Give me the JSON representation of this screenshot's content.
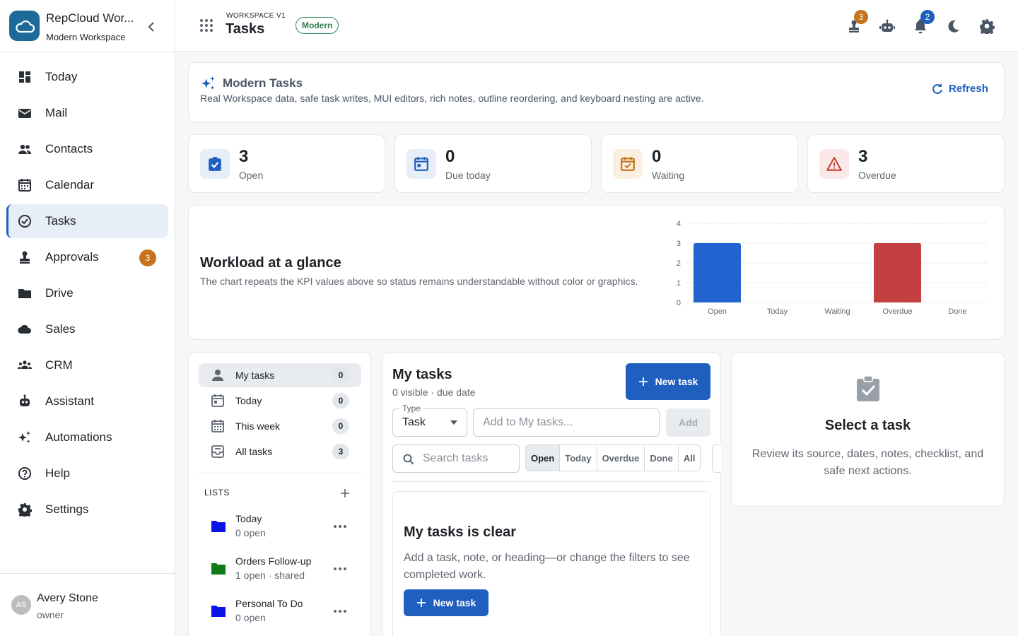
{
  "sidebar": {
    "brand_name": "RepCloud Wor...",
    "brand_sub": "Modern Workspace",
    "items": [
      {
        "label": "Today",
        "icon": "dashboard-icon"
      },
      {
        "label": "Mail",
        "icon": "mail-icon"
      },
      {
        "label": "Contacts",
        "icon": "people-icon"
      },
      {
        "label": "Calendar",
        "icon": "calendar-icon"
      },
      {
        "label": "Tasks",
        "icon": "task-check-icon",
        "active": true
      },
      {
        "label": "Approvals",
        "icon": "approval-icon",
        "badge": "3"
      },
      {
        "label": "Drive",
        "icon": "folder-icon"
      },
      {
        "label": "Sales",
        "icon": "cloud-icon"
      },
      {
        "label": "CRM",
        "icon": "groups-icon"
      },
      {
        "label": "Assistant",
        "icon": "robot-icon"
      },
      {
        "label": "Automations",
        "icon": "sparkle-icon"
      },
      {
        "label": "Help",
        "icon": "help-icon"
      },
      {
        "label": "Settings",
        "icon": "gear-icon"
      }
    ],
    "user": {
      "initials": "AS",
      "name": "Avery Stone",
      "role": "owner"
    }
  },
  "topbar": {
    "workspace_label": "WORKSPACE V1",
    "title": "Tasks",
    "chip": "Modern",
    "approvals_badge": "3",
    "notifications_badge": "2"
  },
  "banner": {
    "title": "Modern Tasks",
    "text": "Real Workspace data, safe task writes, MUI editors, rich notes, outline reordering, and keyboard nesting are active.",
    "refresh": "Refresh"
  },
  "kpis": [
    {
      "value": "3",
      "label": "Open",
      "color": "#1f5fbf"
    },
    {
      "value": "0",
      "label": "Due today",
      "color": "#1f5fbf"
    },
    {
      "value": "0",
      "label": "Waiting",
      "color": "#c5731c"
    },
    {
      "value": "3",
      "label": "Overdue",
      "color": "#c0392b"
    }
  ],
  "workload": {
    "title": "Workload at a glance",
    "text": "The chart repeats the KPI values above so status remains understandable without color or graphics."
  },
  "chart_data": {
    "type": "bar",
    "categories": [
      "Open",
      "Today",
      "Waiting",
      "Overdue",
      "Done"
    ],
    "values": [
      3,
      0,
      0,
      3,
      0
    ],
    "colors": [
      "#2164cf",
      "#2164cf",
      "#c5731c",
      "#c44040",
      "#2e8b57"
    ],
    "ylim": [
      0,
      4
    ],
    "yticks": [
      "0",
      "1",
      "2",
      "3",
      "4"
    ],
    "grid": true
  },
  "filters": [
    {
      "label": "My tasks",
      "count": "0",
      "icon": "person-icon",
      "selected": true
    },
    {
      "label": "Today",
      "count": "0",
      "icon": "calendar-today-icon"
    },
    {
      "label": "This week",
      "count": "0",
      "icon": "calendar-week-icon"
    },
    {
      "label": "All tasks",
      "count": "3",
      "icon": "inbox-icon"
    }
  ],
  "lists": {
    "header": "LISTS",
    "items": [
      {
        "name": "Today",
        "sub": "0 open",
        "color": "#0a14e6"
      },
      {
        "name": "Orders Follow-up",
        "sub": "1 open · shared",
        "color": "#0f7d17"
      },
      {
        "name": "Personal To Do",
        "sub": "0 open",
        "color": "#0a14e6"
      }
    ]
  },
  "tasks": {
    "title": "My tasks",
    "subtitle": "0 visible · due date",
    "new_task": "New task",
    "type_label": "Type",
    "type_value": "Task",
    "add_placeholder": "Add to My tasks...",
    "add_button": "Add",
    "search_placeholder": "Search tasks",
    "tabs": [
      "Open",
      "Today",
      "Overdue",
      "Done",
      "All"
    ],
    "empty_title": "My tasks is clear",
    "empty_text": "Add a task, note, or heading—or change the filters to see completed work.",
    "empty_button": "New task"
  },
  "detail": {
    "title": "Select a task",
    "text": "Review its source, dates, notes, checklist, and safe next actions."
  }
}
